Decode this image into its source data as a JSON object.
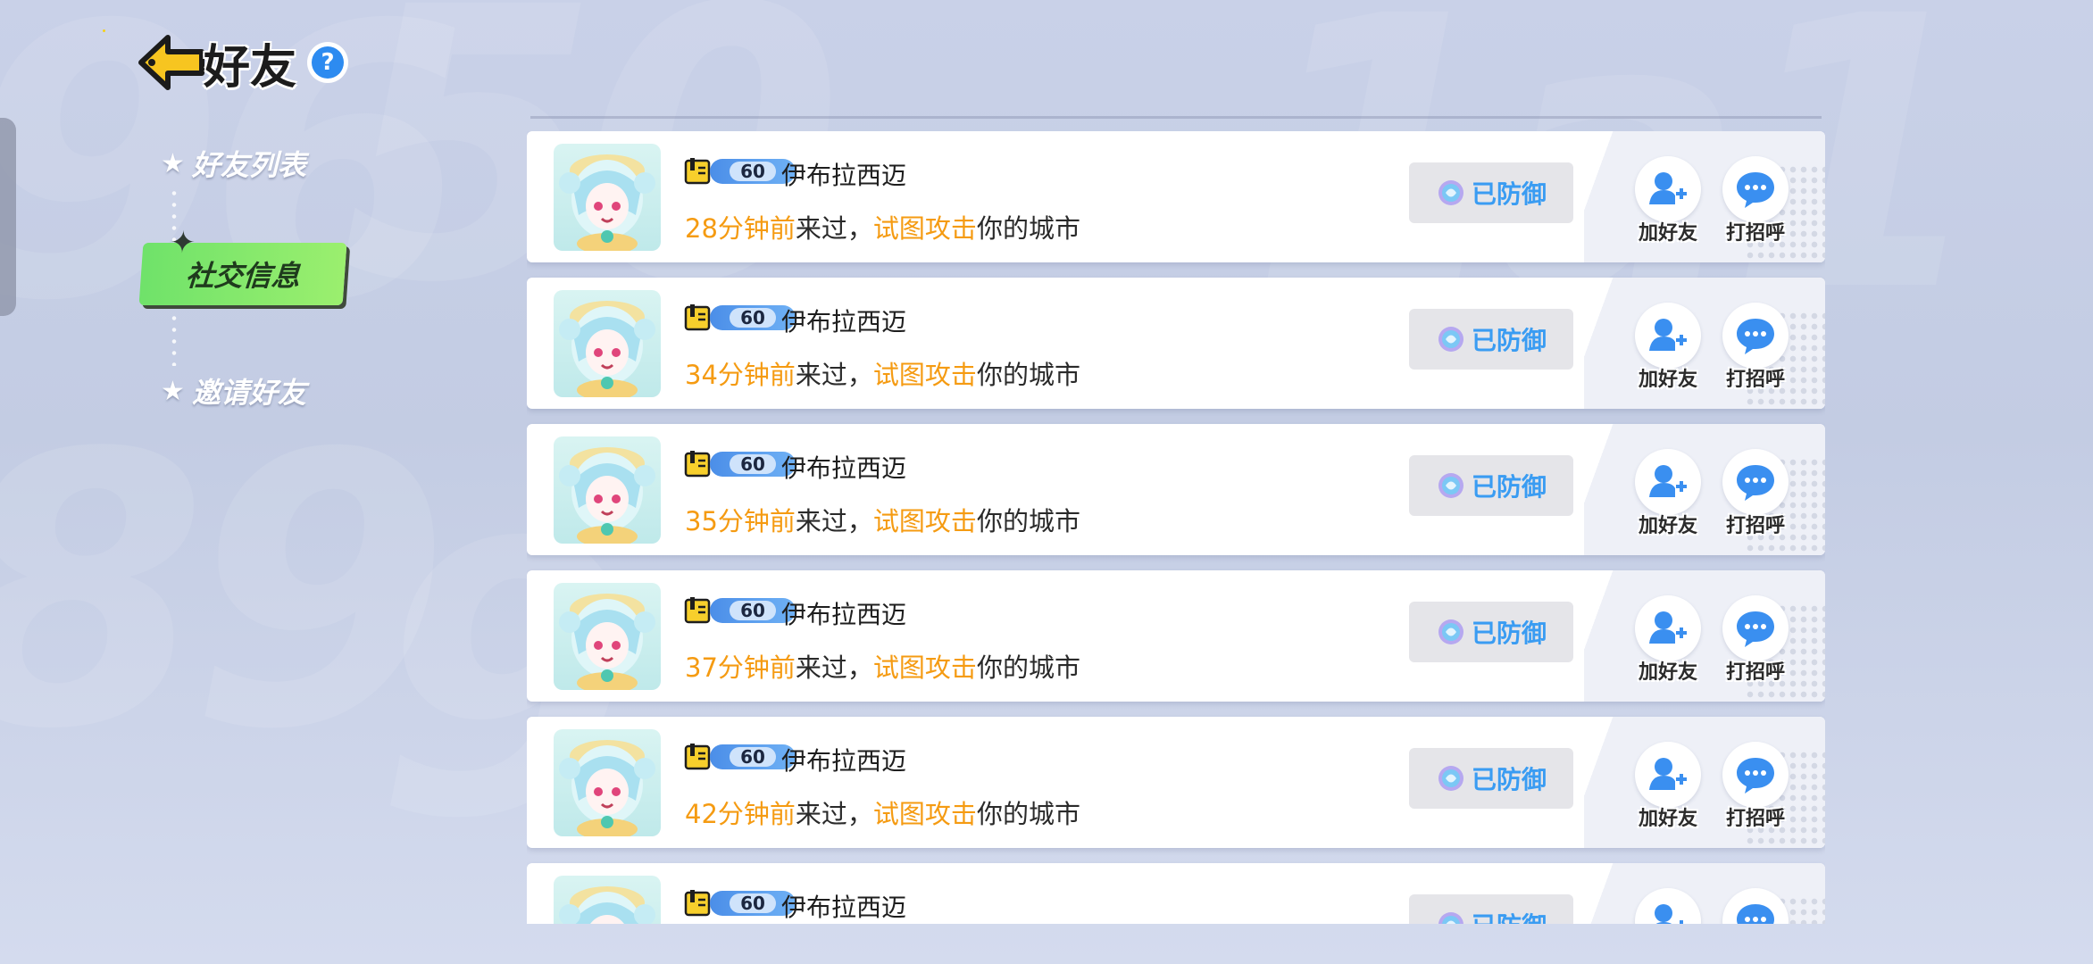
{
  "header": {
    "title": "好友",
    "help_label": "?"
  },
  "nav": {
    "items": [
      {
        "label": "好友列表",
        "active": false
      },
      {
        "label": "社交信息",
        "active": true
      },
      {
        "label": "邀请好友",
        "active": false
      }
    ]
  },
  "colors": {
    "accent_orange": "#f59b12",
    "accent_blue": "#3a9cf2",
    "active_tab_green": "#6fe26a"
  },
  "records": [
    {
      "level": "60",
      "name": "伊布拉西迈",
      "time": "28分钟前",
      "came": "来过，",
      "action": "试图攻击",
      "target": "你的城市",
      "status": "已防御",
      "add_label": "加好友",
      "greet_label": "打招呼"
    },
    {
      "level": "60",
      "name": "伊布拉西迈",
      "time": "34分钟前",
      "came": "来过，",
      "action": "试图攻击",
      "target": "你的城市",
      "status": "已防御",
      "add_label": "加好友",
      "greet_label": "打招呼"
    },
    {
      "level": "60",
      "name": "伊布拉西迈",
      "time": "35分钟前",
      "came": "来过，",
      "action": "试图攻击",
      "target": "你的城市",
      "status": "已防御",
      "add_label": "加好友",
      "greet_label": "打招呼"
    },
    {
      "level": "60",
      "name": "伊布拉西迈",
      "time": "37分钟前",
      "came": "来过，",
      "action": "试图攻击",
      "target": "你的城市",
      "status": "已防御",
      "add_label": "加好友",
      "greet_label": "打招呼"
    },
    {
      "level": "60",
      "name": "伊布拉西迈",
      "time": "42分钟前",
      "came": "来过，",
      "action": "试图攻击",
      "target": "你的城市",
      "status": "已防御",
      "add_label": "加好友",
      "greet_label": "打招呼"
    },
    {
      "level": "60",
      "name": "伊布拉西迈",
      "time": "",
      "came": "",
      "action": "",
      "target": "",
      "status": "已防御",
      "add_label": "",
      "greet_label": ""
    }
  ]
}
